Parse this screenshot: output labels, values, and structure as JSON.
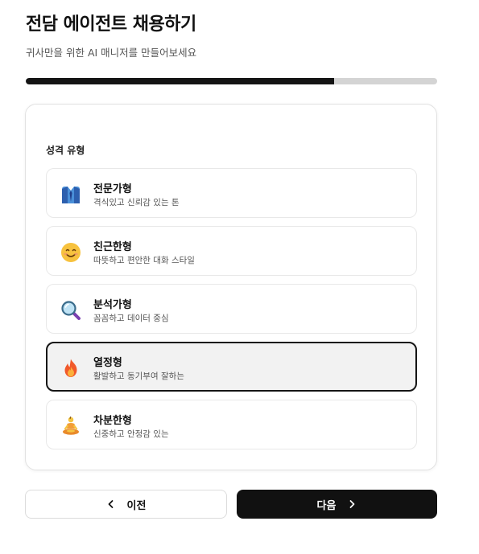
{
  "header": {
    "title": "전담 에이전트 채용하기",
    "subtitle": "귀사만을 위한 AI 매니저를 만들어보세요"
  },
  "progress": {
    "fraction": 0.75
  },
  "personality": {
    "section_label": "성격 유형",
    "selected_index": 3,
    "options": [
      {
        "title": "전문가형",
        "desc": "격식있고 신뢰감 있는 톤",
        "icon": "necktie-icon"
      },
      {
        "title": "친근한형",
        "desc": "따뜻하고 편안한 대화 스타일",
        "icon": "smiling-face-icon"
      },
      {
        "title": "분석가형",
        "desc": "꼼꼼하고 데이터 중심",
        "icon": "magnifying-glass-icon"
      },
      {
        "title": "열정형",
        "desc": "활발하고 동기부여 잘하는",
        "icon": "fire-icon"
      },
      {
        "title": "차분한형",
        "desc": "신중하고 안정감 있는",
        "icon": "meditating-person-icon"
      }
    ]
  },
  "nav": {
    "prev_label": "이전",
    "next_label": "다음"
  }
}
